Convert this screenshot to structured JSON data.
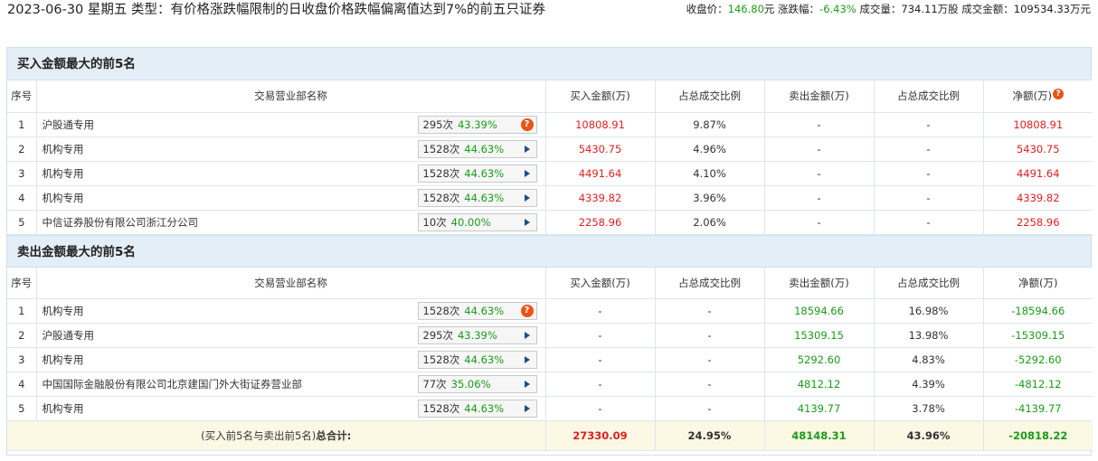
{
  "header": {
    "title": "2023-06-30 星期五 类型：有价格涨跌幅限制的日收盘价格跌幅偏离值达到7%的前五只证券",
    "close_label": "收盘价：",
    "close_value": "146.80",
    "close_unit": "元",
    "change_label": "涨跌幅：",
    "change_value": "-6.43%",
    "volume_label": "成交量：",
    "volume_value": "734.11万股",
    "amount_label": "成交金额：",
    "amount_value": "109534.33万元"
  },
  "columns": {
    "seq": "序号",
    "broker": "交易营业部名称",
    "buy_amount": "买入金额(万)",
    "buy_ratio": "占总成交比例",
    "sell_amount": "卖出金额(万)",
    "sell_ratio": "占总成交比例",
    "net": "净额(万)"
  },
  "buy_section": {
    "title": "买入金额最大的前5名",
    "rows": [
      {
        "seq": "1",
        "broker": "沪股通专用",
        "times": "295次",
        "rate": "43.39%",
        "buy": "10808.91",
        "buy_ratio": "9.87%",
        "sell": "-",
        "sell_ratio": "-",
        "net": "10808.91"
      },
      {
        "seq": "2",
        "broker": "机构专用",
        "times": "1528次",
        "rate": "44.63%",
        "buy": "5430.75",
        "buy_ratio": "4.96%",
        "sell": "-",
        "sell_ratio": "-",
        "net": "5430.75"
      },
      {
        "seq": "3",
        "broker": "机构专用",
        "times": "1528次",
        "rate": "44.63%",
        "buy": "4491.64",
        "buy_ratio": "4.10%",
        "sell": "-",
        "sell_ratio": "-",
        "net": "4491.64"
      },
      {
        "seq": "4",
        "broker": "机构专用",
        "times": "1528次",
        "rate": "44.63%",
        "buy": "4339.82",
        "buy_ratio": "3.96%",
        "sell": "-",
        "sell_ratio": "-",
        "net": "4339.82"
      },
      {
        "seq": "5",
        "broker": "中信证券股份有限公司浙江分公司",
        "times": "10次",
        "rate": "40.00%",
        "buy": "2258.96",
        "buy_ratio": "2.06%",
        "sell": "-",
        "sell_ratio": "-",
        "net": "2258.96"
      }
    ]
  },
  "sell_section": {
    "title": "卖出金额最大的前5名",
    "rows": [
      {
        "seq": "1",
        "broker": "机构专用",
        "times": "1528次",
        "rate": "44.63%",
        "buy": "-",
        "buy_ratio": "-",
        "sell": "18594.66",
        "sell_ratio": "16.98%",
        "net": "-18594.66"
      },
      {
        "seq": "2",
        "broker": "沪股通专用",
        "times": "295次",
        "rate": "43.39%",
        "buy": "-",
        "buy_ratio": "-",
        "sell": "15309.15",
        "sell_ratio": "13.98%",
        "net": "-15309.15"
      },
      {
        "seq": "3",
        "broker": "机构专用",
        "times": "1528次",
        "rate": "44.63%",
        "buy": "-",
        "buy_ratio": "-",
        "sell": "5292.60",
        "sell_ratio": "4.83%",
        "net": "-5292.60"
      },
      {
        "seq": "4",
        "broker": "中国国际金融股份有限公司北京建国门外大街证券营业部",
        "times": "77次",
        "rate": "35.06%",
        "buy": "-",
        "buy_ratio": "-",
        "sell": "4812.12",
        "sell_ratio": "4.39%",
        "net": "-4812.12"
      },
      {
        "seq": "5",
        "broker": "机构专用",
        "times": "1528次",
        "rate": "44.63%",
        "buy": "-",
        "buy_ratio": "-",
        "sell": "4139.77",
        "sell_ratio": "3.78%",
        "net": "-4139.77"
      }
    ]
  },
  "total": {
    "label_prefix": "(买入前5名与卖出前5名)",
    "label_bold": "总合计:",
    "buy": "27330.09",
    "buy_ratio": "24.95%",
    "sell": "48148.31",
    "sell_ratio": "43.96%",
    "net": "-20818.22"
  },
  "icons": {
    "help": "question-icon",
    "expand": "play-arrow-icon"
  },
  "colors": {
    "up": "#e02020",
    "down": "#1a9b1a",
    "section_bg": "#e3eef7",
    "total_bg": "#fbf8e4",
    "help_icon": "#e8541a"
  }
}
